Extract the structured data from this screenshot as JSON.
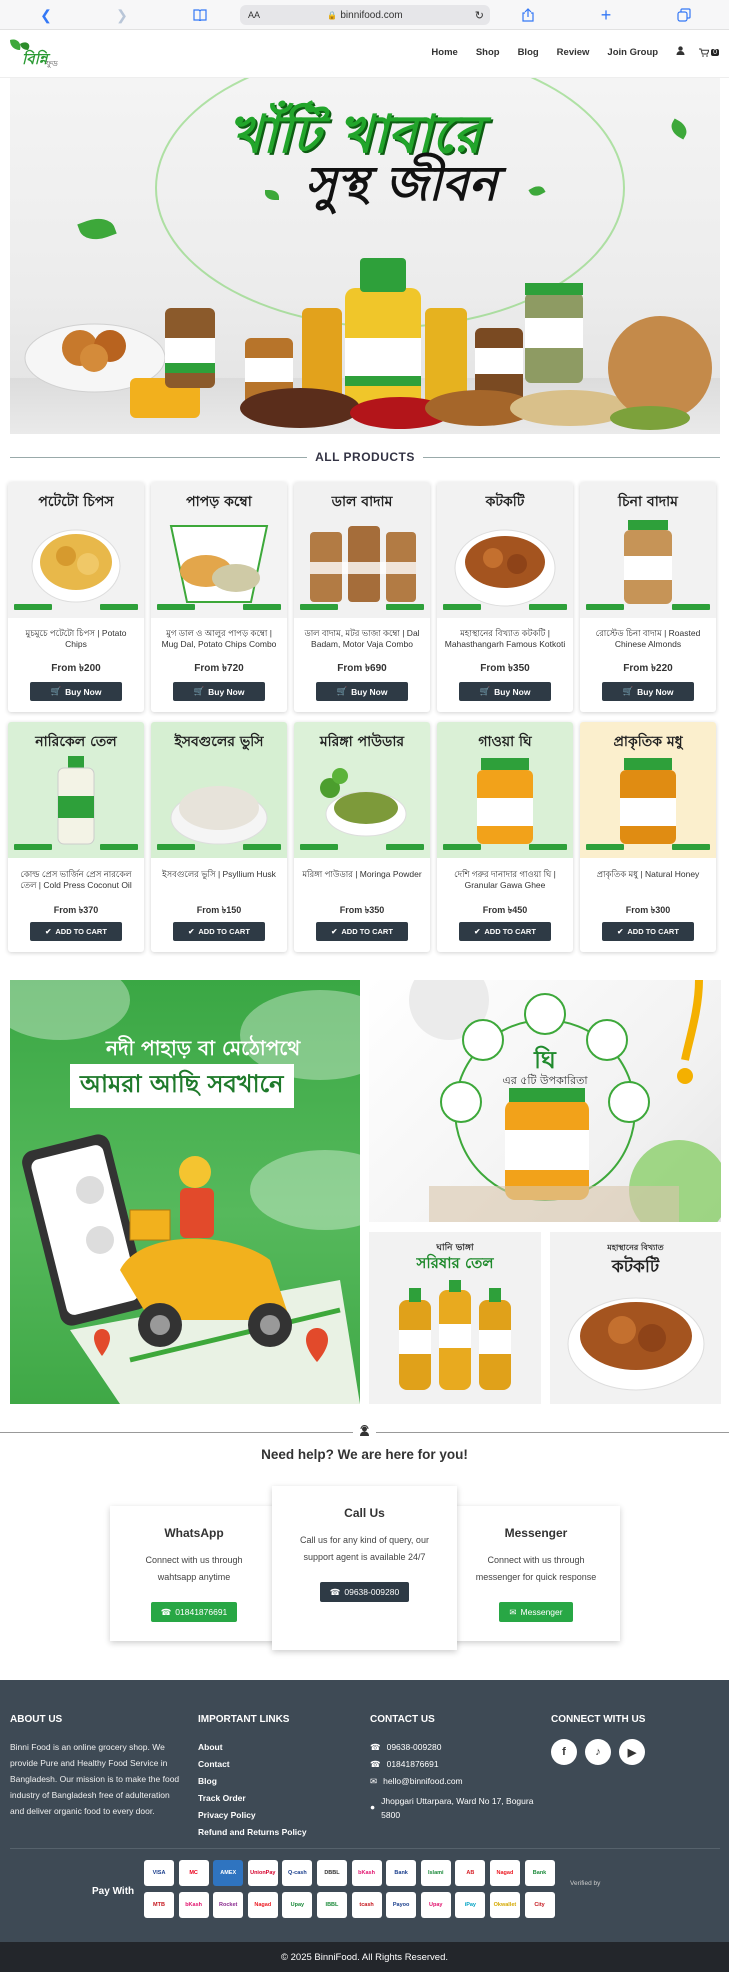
{
  "browser": {
    "aa_label": "AA",
    "url": "binnifood.com"
  },
  "nav": {
    "items": [
      "Home",
      "Shop",
      "Blog",
      "Review",
      "Join Group"
    ],
    "cart_count": "0"
  },
  "hero": {
    "line1": "খাঁটি খাবারে",
    "line2": "সুস্থ জীবন"
  },
  "products_section": {
    "title": "ALL PRODUCTS"
  },
  "products_row1": [
    {
      "img_label": "পটেটো চিপস",
      "name": "মুচমুচে পটেটো চিপস | Potato Chips",
      "price": "From ৳200",
      "btn": "Buy Now",
      "bg": "#f2f2f2"
    },
    {
      "img_label": "পাপড় কম্বো",
      "name": "মুগ ডাল ও আলুর পাপড় কম্বো | Mug Dal, Potato Chips Combo",
      "price": "From ৳720",
      "btn": "Buy Now",
      "bg": "#f3f3f3"
    },
    {
      "img_label": "ডাল বাদাম",
      "name": "ডাল বাদাম, মটর ভাজা কম্বো | Dal Badam, Motor Vaja Combo",
      "price": "From ৳690",
      "btn": "Buy Now",
      "bg": "#f1f1f1"
    },
    {
      "img_label": "কটকটি",
      "name": "মহাস্থানের বিখ্যাত কটকটি | Mahasthangarh Famous Kotkoti",
      "price": "From ৳350",
      "btn": "Buy Now",
      "bg": "#f2f2f2"
    },
    {
      "img_label": "চিনা বাদাম",
      "name": "রোস্টেড চিনা বাদাম | Roasted Chinese Almonds",
      "price": "From ৳220",
      "btn": "Buy Now",
      "bg": "#f2f2f2"
    }
  ],
  "products_row2": [
    {
      "img_label": "নারিকেল তেল",
      "name": "কোল্ড প্রেস ভার্জিন প্রেস নারকেল তেল | Cold Press Coconut Oil",
      "price": "From ৳370",
      "btn": "ADD TO CART",
      "bg": "#d9f0d6"
    },
    {
      "img_label": "ইসবগুলের ভুসি",
      "name": "ইসবগুলের ভুসি | Psyllium Husk",
      "price": "From ৳150",
      "btn": "ADD TO CART",
      "bg": "#d6efd2"
    },
    {
      "img_label": "মরিঙ্গা পাউডার",
      "name": "মরিঙ্গা পাউডার | Moringa Powder",
      "price": "From ৳350",
      "btn": "ADD TO CART",
      "bg": "#dcf1d8"
    },
    {
      "img_label": "গাওয়া ঘি",
      "name": "দেশি গরুর দানাদার গাওয়া ঘি | Granular Gawa Ghee",
      "price": "From ৳450",
      "btn": "ADD TO CART",
      "bg": "#daf0d6"
    },
    {
      "img_label": "প্রাকৃতিক মধু",
      "name": "প্রাকৃতিক মধু | Natural Honey",
      "price": "From ৳300",
      "btn": "ADD TO CART",
      "bg": "#fbefcd"
    }
  ],
  "promos": {
    "delivery_line1": "নদী পাহাড় বা মেঠোপথে",
    "delivery_line2": "আমরা আছি সবখানে",
    "ghee_title": "ঘি",
    "ghee_sub": "এর ৫টি উপকারিতা",
    "oil_title": "সরিষার তেল",
    "oil_pre": "ঘানি ভাঙ্গা",
    "kotkoti_title": "কটকটি",
    "kotkoti_pre": "মহাস্থানের বিখ্যাত"
  },
  "help": {
    "title": "Need help? We are here for you!",
    "cards": [
      {
        "title": "WhatsApp",
        "desc": "Connect with us through wahtsapp anytime",
        "btn": "01841876691",
        "color": "#28a745"
      },
      {
        "title": "Call Us",
        "desc": "Call us for any kind of query, our support agent is available 24/7",
        "btn": "09638-009280",
        "color": "#2e3a45"
      },
      {
        "title": "Messenger",
        "desc": "Connect with us through messenger for quick response",
        "btn": "Messenger",
        "color": "#28a745"
      }
    ]
  },
  "footer": {
    "about_title": "ABOUT US",
    "about_text": "Binni Food is an online grocery shop. We provide Pure and Healthy Food Service in Bangladesh. Our mission is to make the food industry of Bangladesh free of adulteration and deliver organic food to every door.",
    "links_title": "IMPORTANT LINKS",
    "links": [
      "About",
      "Contact",
      "Blog",
      "Track Order",
      "Privacy Policy",
      "Refund and Returns Policy"
    ],
    "contact_title": "CONTACT US",
    "contact": [
      "09638-009280",
      "01841876691",
      "hello@binnifood.com",
      "Jhopgari Uttarpara, Ward No 17, Bogura 5800"
    ],
    "connect_title": "CONNECT WITH US",
    "pay_with": "Pay With",
    "verified": "Verified by",
    "pay_methods": [
      "VISA",
      "MC",
      "AMEX",
      "UnionPay",
      "Q-cash",
      "DBBL",
      "bKash",
      "Bank",
      "Islami",
      "AB",
      "Nagad",
      "Bank",
      "MTB",
      "bKash",
      "Rocket",
      "Nagad",
      "Upay",
      "IBBL",
      "tcash",
      "Payoo",
      "Upay",
      "iPay",
      "Okwallet",
      "City"
    ],
    "copyright": "© 2025 BinniFood. All Rights Reserved."
  }
}
